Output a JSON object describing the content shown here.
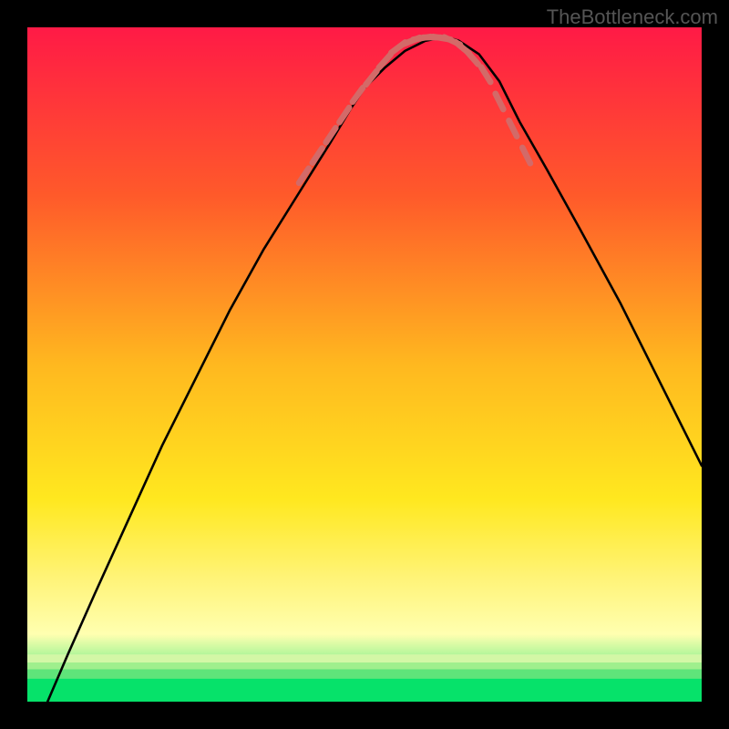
{
  "watermark": "TheBottleneck.com",
  "chart_data": {
    "type": "line",
    "title": "",
    "xlabel": "",
    "ylabel": "",
    "xlim": [
      0,
      100
    ],
    "ylim": [
      0,
      100
    ],
    "grid": false,
    "legend": false,
    "background": {
      "gradient_stops": [
        {
          "offset": 0,
          "color": "#ff1a46"
        },
        {
          "offset": 25,
          "color": "#ff5a2a"
        },
        {
          "offset": 50,
          "color": "#ffb81f"
        },
        {
          "offset": 70,
          "color": "#ffe81f"
        },
        {
          "offset": 82,
          "color": "#fff47a"
        },
        {
          "offset": 90,
          "color": "#ffffb0"
        },
        {
          "offset": 100,
          "color": "#06e26a"
        }
      ],
      "green_bands": [
        {
          "y": 93,
          "h": 1.2,
          "color": "#d3f7a6"
        },
        {
          "y": 94.2,
          "h": 1.0,
          "color": "#9fef8d"
        },
        {
          "y": 95.2,
          "h": 1.4,
          "color": "#5fe47a"
        },
        {
          "y": 96.6,
          "h": 3.4,
          "color": "#06e26a"
        }
      ]
    },
    "series": [
      {
        "name": "curve",
        "stroke": "#000000",
        "stroke_width": 2.5,
        "x": [
          3,
          6,
          10,
          15,
          20,
          25,
          30,
          35,
          40,
          45,
          48,
          50,
          53,
          56,
          59,
          62,
          64,
          67,
          70,
          73,
          77,
          82,
          88,
          94,
          100
        ],
        "y": [
          0,
          7,
          16,
          27,
          38,
          48,
          58,
          67,
          75,
          83,
          88,
          91,
          94,
          96.5,
          98,
          98.6,
          98,
          96,
          92,
          86,
          79,
          70,
          59,
          47,
          35
        ]
      },
      {
        "name": "bottom-dash",
        "stroke": "#d36a68",
        "stroke_width": 6,
        "dash": true,
        "x": [
          41,
          43,
          45,
          47,
          49,
          51,
          53,
          55,
          57,
          58.5,
          60,
          61.5,
          63,
          64.5,
          66,
          68,
          70,
          72,
          74
        ],
        "y": [
          78,
          81,
          84,
          87,
          90,
          92.5,
          95,
          97,
          98,
          98.4,
          98.5,
          98.4,
          98,
          97,
          95.5,
          93,
          89,
          85,
          81
        ]
      }
    ]
  }
}
